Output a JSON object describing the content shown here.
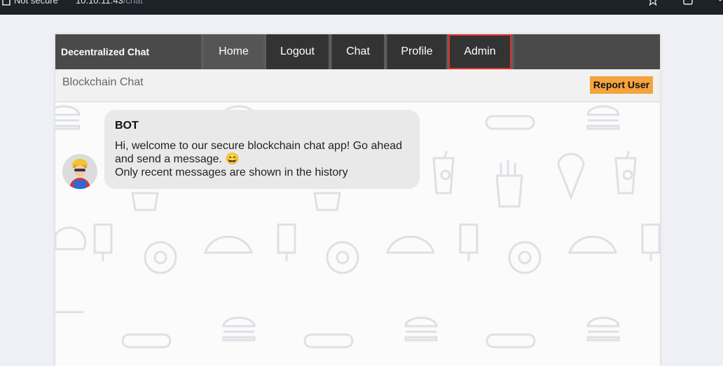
{
  "browser": {
    "security_label": "Not secure",
    "url_host": "10.10.11.43",
    "url_path": "/chat"
  },
  "navbar": {
    "brand": "Decentralized Chat",
    "items": [
      {
        "label": "Home"
      },
      {
        "label": "Logout"
      },
      {
        "label": "Chat"
      },
      {
        "label": "Profile"
      },
      {
        "label": "Admin",
        "highlighted": true
      }
    ]
  },
  "subheader": {
    "title": "Blockchain Chat",
    "report_label": "Report User"
  },
  "messages": [
    {
      "sender": "BOT",
      "lines": [
        "Hi, welcome to our secure blockchain chat app! Go ahead and send a message. 😄",
        "Only recent messages are shown in the history"
      ],
      "avatar_icon": "bot-avatar-icon"
    }
  ],
  "colors": {
    "navbar_bg": "#4a4a4a",
    "nav_button_bg": "#333333",
    "active_border": "#e0312f",
    "report_button": "#f5a33c",
    "bubble_bg": "#e9e9e9"
  }
}
